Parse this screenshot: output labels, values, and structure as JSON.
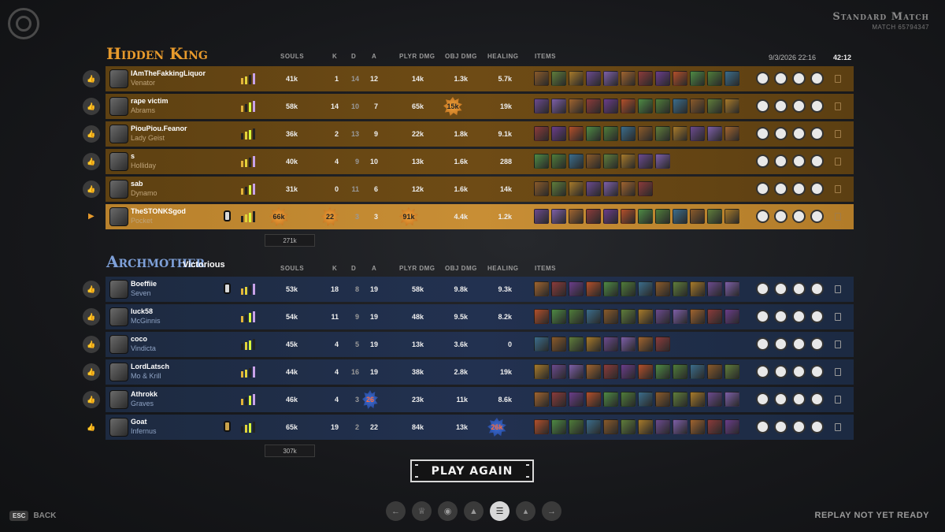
{
  "match": {
    "type": "Standard Match",
    "id": "MATCH 65794347",
    "datetime": "9/3/2026 22:16",
    "duration": "42:12"
  },
  "columns": {
    "souls": "SOULS",
    "k": "K",
    "d": "D",
    "a": "A",
    "plyr_dmg": "PLYR DMG",
    "obj_dmg": "OBJ DMG",
    "healing": "HEALING",
    "items": "ITEMS"
  },
  "teams": [
    {
      "name": "Hidden King",
      "result": "",
      "color": "#e79a2c",
      "total_souls": "271k",
      "players": [
        {
          "name": "IAmTheFakkingLiquor",
          "hero": "Venator",
          "souls": "41k",
          "k": "1",
          "d": "14",
          "a": "12",
          "plyr_dmg": "14k",
          "obj_dmg": "1.3k",
          "healing": "5.7k",
          "highlight": false,
          "items": 12
        },
        {
          "name": "rape victim",
          "hero": "Abrams",
          "souls": "58k",
          "k": "14",
          "d": "10",
          "a": "7",
          "plyr_dmg": "65k",
          "obj_dmg": "15k",
          "healing": "19k",
          "highlight": false,
          "items": 12
        },
        {
          "name": "PiouPiou.Feanor",
          "hero": "Lady Geist",
          "souls": "36k",
          "k": "2",
          "d": "13",
          "a": "9",
          "plyr_dmg": "22k",
          "obj_dmg": "1.8k",
          "healing": "9.1k",
          "highlight": false,
          "items": 12
        },
        {
          "name": "s",
          "hero": "Holliday",
          "souls": "40k",
          "k": "4",
          "d": "9",
          "a": "10",
          "plyr_dmg": "13k",
          "obj_dmg": "1.6k",
          "healing": "288",
          "highlight": false,
          "items": 8
        },
        {
          "name": "sab",
          "hero": "Dynamo",
          "souls": "31k",
          "k": "0",
          "d": "11",
          "a": "6",
          "plyr_dmg": "12k",
          "obj_dmg": "1.6k",
          "healing": "14k",
          "highlight": false,
          "items": 7
        },
        {
          "name": "TheSTONKSgod",
          "hero": "Pocket",
          "souls": "66k",
          "k": "22",
          "d": "3",
          "a": "3",
          "plyr_dmg": "91k",
          "obj_dmg": "4.4k",
          "healing": "1.2k",
          "highlight": true,
          "items": 12
        }
      ]
    },
    {
      "name": "Archmother",
      "result": "Victorious",
      "color": "#7ea0d8",
      "total_souls": "307k",
      "players": [
        {
          "name": "Boeffiie",
          "hero": "Seven",
          "souls": "53k",
          "k": "18",
          "d": "8",
          "a": "19",
          "plyr_dmg": "58k",
          "obj_dmg": "9.8k",
          "healing": "9.3k",
          "items": 12
        },
        {
          "name": "luck58",
          "hero": "McGinnis",
          "souls": "54k",
          "k": "11",
          "d": "9",
          "a": "19",
          "plyr_dmg": "48k",
          "obj_dmg": "9.5k",
          "healing": "8.2k",
          "items": 12
        },
        {
          "name": "coco",
          "hero": "Vindicta",
          "souls": "45k",
          "k": "4",
          "d": "5",
          "a": "19",
          "plyr_dmg": "13k",
          "obj_dmg": "3.6k",
          "healing": "0",
          "items": 8
        },
        {
          "name": "LordLatsch",
          "hero": "Mo & Krill",
          "souls": "44k",
          "k": "4",
          "d": "16",
          "a": "19",
          "plyr_dmg": "38k",
          "obj_dmg": "2.8k",
          "healing": "19k",
          "items": 12
        },
        {
          "name": "Athrokk",
          "hero": "Graves",
          "souls": "46k",
          "k": "4",
          "d": "3",
          "a": "26",
          "plyr_dmg": "23k",
          "obj_dmg": "11k",
          "healing": "8.6k",
          "items": 12
        },
        {
          "name": "Goat",
          "hero": "Infernus",
          "souls": "65k",
          "k": "19",
          "d": "2",
          "a": "22",
          "plyr_dmg": "84k",
          "obj_dmg": "13k",
          "healing": "26k",
          "items": 12
        }
      ]
    }
  ],
  "buttons": {
    "play_again": "PLAY AGAIN",
    "esc_key": "ESC",
    "back": "BACK"
  },
  "status": {
    "replay": "REPLAY NOT YET READY"
  },
  "nav_icons": [
    "arrow-left-icon",
    "trophy-icon",
    "medal-icon",
    "crest-icon",
    "list-icon",
    "graph-icon",
    "arrow-right-icon"
  ]
}
